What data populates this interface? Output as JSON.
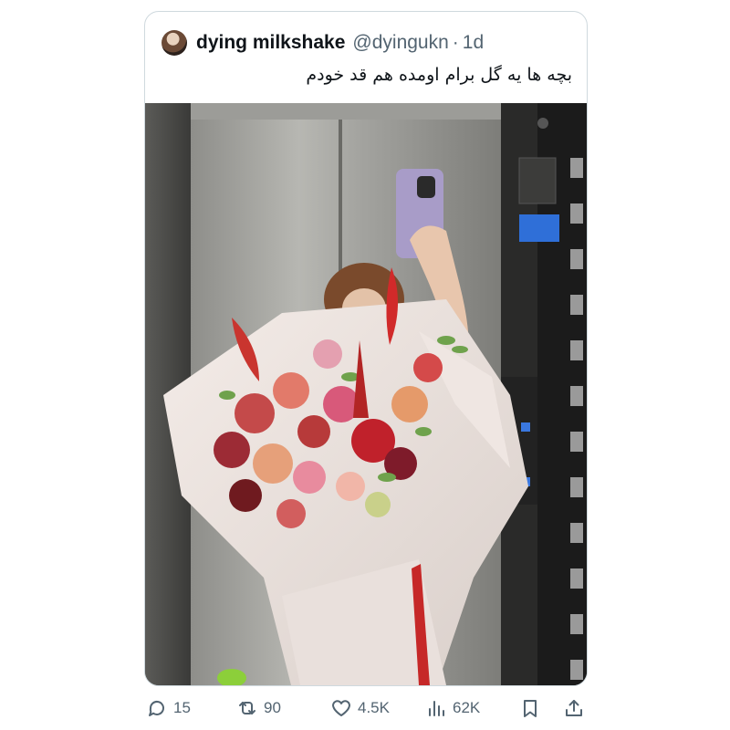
{
  "tweet": {
    "display_name": "dying milkshake",
    "handle": "@dyingukn",
    "separator": "·",
    "age": "1d",
    "text": "بچه ها یه گل برام اومده هم قد خودم",
    "photo_subject": "mirror selfie in an elevator holding a large bouquet of roses"
  },
  "actions": {
    "reply_count": "15",
    "retweet_count": "90",
    "like_count": "4.5K",
    "view_count": "62K"
  },
  "icons": {
    "reply": "reply-icon",
    "retweet": "retweet-icon",
    "like": "heart-icon",
    "views": "views-icon",
    "bookmark": "bookmark-icon",
    "share": "share-icon"
  },
  "colors": {
    "text_primary": "#0f1419",
    "text_secondary": "#536471",
    "border": "#cfd9de"
  }
}
